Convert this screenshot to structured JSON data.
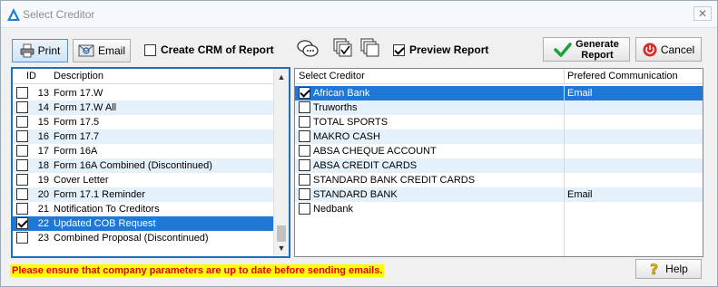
{
  "window": {
    "title": "Select Creditor",
    "close_label": "✕"
  },
  "toolbar": {
    "print_label": "Print",
    "email_label": "Email",
    "create_crm": {
      "label": "Create CRM of Report",
      "checked": false
    },
    "preview_report": {
      "label": "Preview Report",
      "checked": true
    },
    "generate_label_line1": "Generate",
    "generate_label_line2": "Report",
    "cancel_label": "Cancel"
  },
  "reports": {
    "headers": {
      "id": "ID",
      "description": "Description"
    },
    "rows": [
      {
        "id": "13",
        "description": "Form 17.W",
        "checked": false,
        "selected": false
      },
      {
        "id": "14",
        "description": "Form 17.W All",
        "checked": false,
        "selected": false
      },
      {
        "id": "15",
        "description": "Form 17.5",
        "checked": false,
        "selected": false
      },
      {
        "id": "16",
        "description": "Form 17.7",
        "checked": false,
        "selected": false
      },
      {
        "id": "17",
        "description": "Form 16A",
        "checked": false,
        "selected": false
      },
      {
        "id": "18",
        "description": "Form 16A Combined (Discontinued)",
        "checked": false,
        "selected": false
      },
      {
        "id": "19",
        "description": "Cover Letter",
        "checked": false,
        "selected": false
      },
      {
        "id": "20",
        "description": "Form 17.1 Reminder",
        "checked": false,
        "selected": false
      },
      {
        "id": "21",
        "description": "Notification To Creditors",
        "checked": false,
        "selected": false
      },
      {
        "id": "22",
        "description": "Updated COB Request",
        "checked": true,
        "selected": true
      },
      {
        "id": "23",
        "description": "Combined Proposal (Discontinued)",
        "checked": false,
        "selected": false
      }
    ]
  },
  "creditors": {
    "headers": {
      "creditor": "Select Creditor",
      "communication": "Prefered Communication"
    },
    "rows": [
      {
        "name": "African Bank",
        "communication": "Email",
        "checked": true,
        "selected": true
      },
      {
        "name": "Truworths",
        "communication": "",
        "checked": false,
        "selected": false
      },
      {
        "name": "TOTAL SPORTS",
        "communication": "",
        "checked": false,
        "selected": false
      },
      {
        "name": "MAKRO CASH",
        "communication": "",
        "checked": false,
        "selected": false
      },
      {
        "name": "ABSA CHEQUE ACCOUNT",
        "communication": "",
        "checked": false,
        "selected": false
      },
      {
        "name": "ABSA CREDIT CARDS",
        "communication": "",
        "checked": false,
        "selected": false
      },
      {
        "name": "STANDARD BANK CREDIT CARDS",
        "communication": "",
        "checked": false,
        "selected": false
      },
      {
        "name": "STANDARD BANK",
        "communication": "Email",
        "checked": false,
        "selected": false
      },
      {
        "name": "Nedbank",
        "communication": "",
        "checked": false,
        "selected": false
      }
    ]
  },
  "footer": {
    "warning": "Please ensure that company parameters are up to date before sending emails.",
    "help_label": "Help"
  },
  "colors": {
    "selection": "#1e78d4",
    "alt_row": "#e4f1fb",
    "warning_bg": "#ffff00",
    "warning_text": "#e00000"
  }
}
